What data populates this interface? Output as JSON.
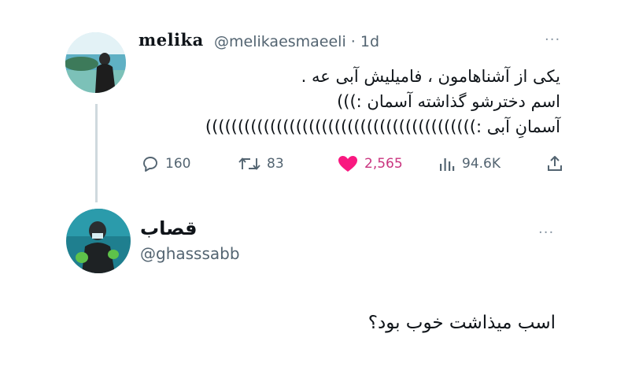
{
  "tweet": {
    "display_name": "melika",
    "handle_and_time": "@melikaesmaeeli · 1d",
    "more": "···",
    "lines": [
      "یکی از آشناهامون ، فامیلیش آبی عه .",
      "اسم دخترشو گذاشته آسمان :)))",
      "آسمانِ آبی :))))))))))))))))))))))))))))))))))))))))))"
    ],
    "stats": {
      "replies": "160",
      "retweets": "83",
      "likes": "2,565",
      "views": "94.6K"
    },
    "like_color": "#f91880"
  },
  "reply": {
    "display_name": "قصاب",
    "handle": "@ghasssabb",
    "more": "···",
    "text": "اسب میذاشت خوب بود؟"
  }
}
